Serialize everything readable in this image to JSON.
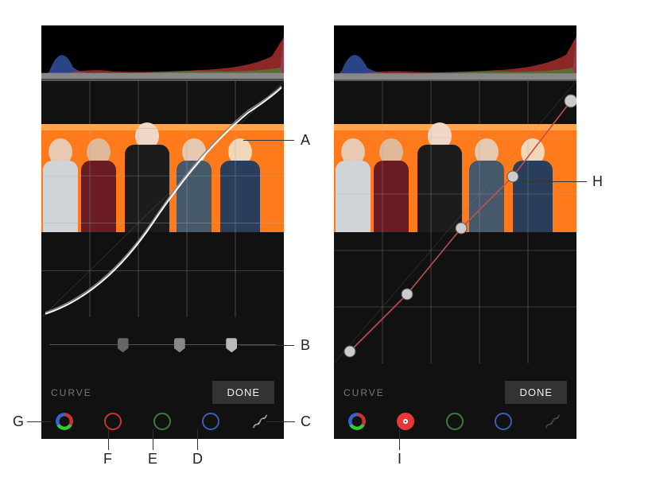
{
  "panels": {
    "left": {
      "tool_label": "CURVE",
      "done_label": "DONE",
      "channels": {
        "rgb": "rgb-all",
        "red": "red-channel",
        "green": "green-channel",
        "blue": "blue-channel",
        "parametric": "parametric-curve"
      },
      "active_channel": "parametric",
      "slider_knobs": [
        0.3,
        0.55,
        0.78
      ]
    },
    "right": {
      "tool_label": "CURVE",
      "done_label": "DONE",
      "channels": {
        "rgb": "rgb-all",
        "red": "red-channel",
        "green": "green-channel",
        "blue": "blue-channel",
        "parametric": "parametric-curve"
      },
      "active_channel": "red"
    }
  },
  "callouts": {
    "A": "A",
    "B": "B",
    "C": "C",
    "D": "D",
    "E": "E",
    "F": "F",
    "G": "G",
    "H": "H",
    "I": "I"
  },
  "colors": {
    "bg_dark": "#111111",
    "accent_orange": "#ff7a1a",
    "red": "#e63838",
    "green": "#3c7a3c",
    "blue": "#3a5fb0",
    "grid": "#808080"
  }
}
